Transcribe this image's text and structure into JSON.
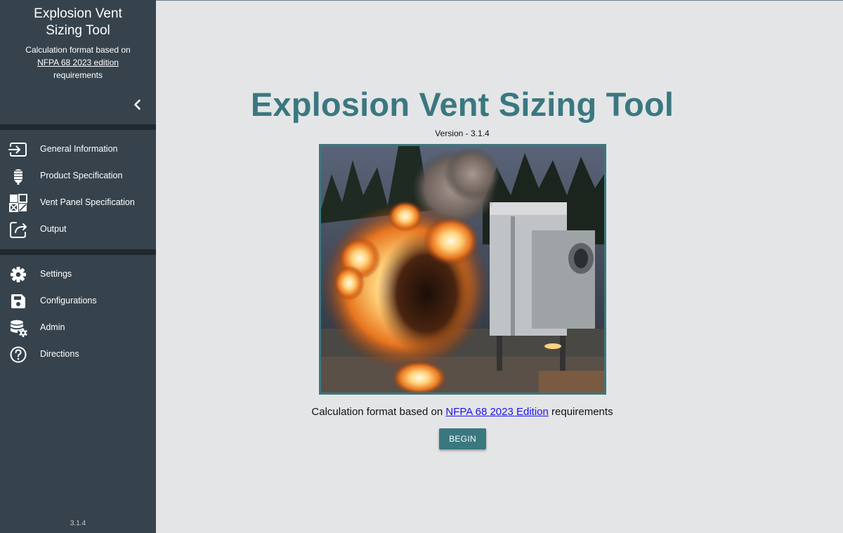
{
  "sidebar": {
    "title": "Explosion Vent Sizing Tool",
    "subtitle_prefix": "Calculation format based on",
    "subtitle_link": "NFPA 68 2023 edition",
    "subtitle_suffix": "requirements",
    "collapse_icon": "chevron-left-icon",
    "primary_nav": [
      {
        "label": "General Information",
        "icon": "login-arrow-icon"
      },
      {
        "label": "Product Specification",
        "icon": "silo-icon"
      },
      {
        "label": "Vent Panel Specification",
        "icon": "panel-grid-icon"
      },
      {
        "label": "Output",
        "icon": "share-output-icon"
      }
    ],
    "secondary_nav": [
      {
        "label": "Settings",
        "icon": "gear-icon"
      },
      {
        "label": "Configurations",
        "icon": "save-icon"
      },
      {
        "label": "Admin",
        "icon": "database-settings-icon"
      },
      {
        "label": "Directions",
        "icon": "help-circle-icon"
      }
    ],
    "version": "3.1.4"
  },
  "main": {
    "title": "Explosion Vent Sizing Tool",
    "version": "Version - 3.1.4",
    "caption_prefix": "Calculation format based on",
    "caption_link": "NFPA 68 2023 Edition",
    "caption_suffix": "requirements",
    "begin_label": "BEGIN"
  },
  "colors": {
    "sidebar_bg": "#36434d",
    "accent": "#3a7880",
    "main_bg": "#e4e5e7",
    "link": "#1a14e6"
  }
}
